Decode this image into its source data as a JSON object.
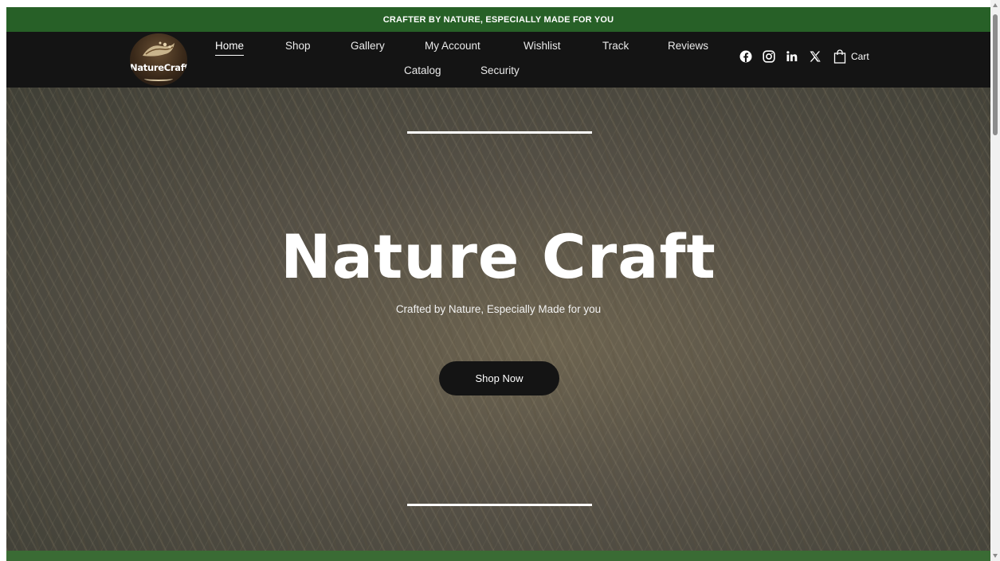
{
  "announcement": "CRAFTER BY NATURE, ESPECIALLY MADE FOR YOU",
  "logo": {
    "text": "NatureCraft"
  },
  "nav": {
    "items": [
      {
        "label": "Home",
        "active": true
      },
      {
        "label": "Shop"
      },
      {
        "label": "Gallery"
      },
      {
        "label": "My Account"
      },
      {
        "label": "Wishlist"
      },
      {
        "label": "Track"
      },
      {
        "label": "Reviews"
      },
      {
        "label": "Catalog"
      },
      {
        "label": "Security"
      }
    ]
  },
  "social": {
    "icons": [
      "facebook-icon",
      "instagram-icon",
      "linkedin-icon",
      "x-icon"
    ],
    "cart_label": "Cart"
  },
  "hero": {
    "title": "Nature Craft",
    "subtitle": "Crafted by Nature, Especially Made for you",
    "button_label": "Shop Now"
  },
  "colors": {
    "announce_bg": "#276027",
    "header_bg": "#141414",
    "button_bg": "#141414",
    "bottom_band": "#3a6b34"
  }
}
